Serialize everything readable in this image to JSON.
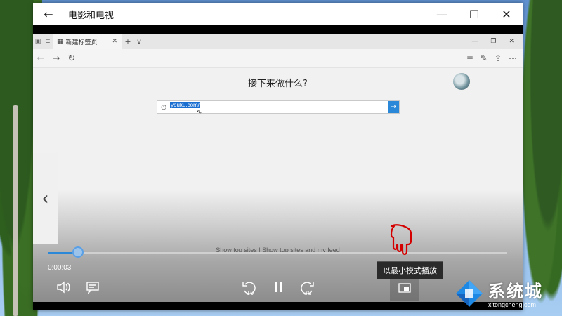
{
  "app": {
    "title": "电影和电视",
    "back_icon": "←",
    "minimize_icon": "—",
    "maximize_icon": "☐",
    "close_icon": "✕"
  },
  "browser": {
    "tab_label": "新建标签页",
    "tab_close": "✕",
    "new_tab": "+",
    "tab_dropdown": "∨",
    "heading": "接下来做什么?",
    "search_value": "youku.com/",
    "top_sites_link": "Show top sites",
    "separator": "|",
    "top_sites_feed_link": "Show top sites and my feed"
  },
  "side_nav": {
    "prev_icon": "‹"
  },
  "player": {
    "current_time": "0:00:03",
    "progress_fraction": 0.065,
    "tooltip": "以最小模式播放",
    "rewind_seconds": "10",
    "forward_seconds": "30"
  },
  "watermark": {
    "brand": "系统城",
    "url": "xitongcheng.com"
  },
  "colors": {
    "accent": "#2b88d8",
    "pointer_hand": "#d40000"
  }
}
